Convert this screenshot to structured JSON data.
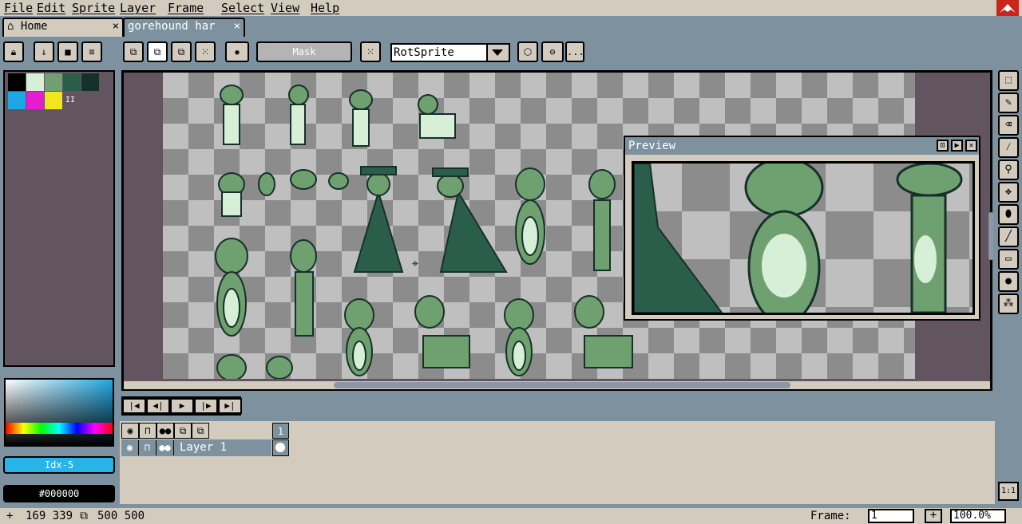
{
  "menu": [
    "File",
    "Edit",
    "Sprite",
    "Layer",
    "Frame",
    "Select",
    "View",
    "Help"
  ],
  "tabs": {
    "home": "Home",
    "sprite": "gorehound har",
    "close": "×"
  },
  "toolbar": {
    "mask": "Mask",
    "rotation_algorithm": "RotSprite",
    "more": "..."
  },
  "palette": {
    "colors": [
      "#000000",
      "#d6efd6",
      "#6fa06f",
      "#2a5e4a",
      "#16302a",
      "#1ca6e6",
      "#e61cd0",
      "#f0e61c"
    ],
    "marker": "II"
  },
  "color_panel": {
    "index": "Idx-5",
    "hex": "#000000"
  },
  "preview": {
    "title": "Preview"
  },
  "layers": {
    "name": "Layer 1",
    "frame_number": "1"
  },
  "timeline_controls": [
    "first-frame",
    "previous-frame",
    "play",
    "next-frame",
    "last-frame"
  ],
  "status": {
    "cursor": "169 339",
    "size": "500 500",
    "frame_label": "Frame:",
    "frame_value": "1",
    "add_frame": "+",
    "zoom": "100.0%",
    "zoom_1to1": "1:1"
  },
  "icons": {
    "tools": [
      "marquee-icon",
      "pencil-icon",
      "eraser-icon",
      "eyedropper-icon",
      "zoom-icon",
      "move-icon",
      "paint-bucket-icon",
      "line-icon",
      "rectangle-icon",
      "blur-icon",
      "spray-icon"
    ]
  },
  "accent": "#7d929e"
}
